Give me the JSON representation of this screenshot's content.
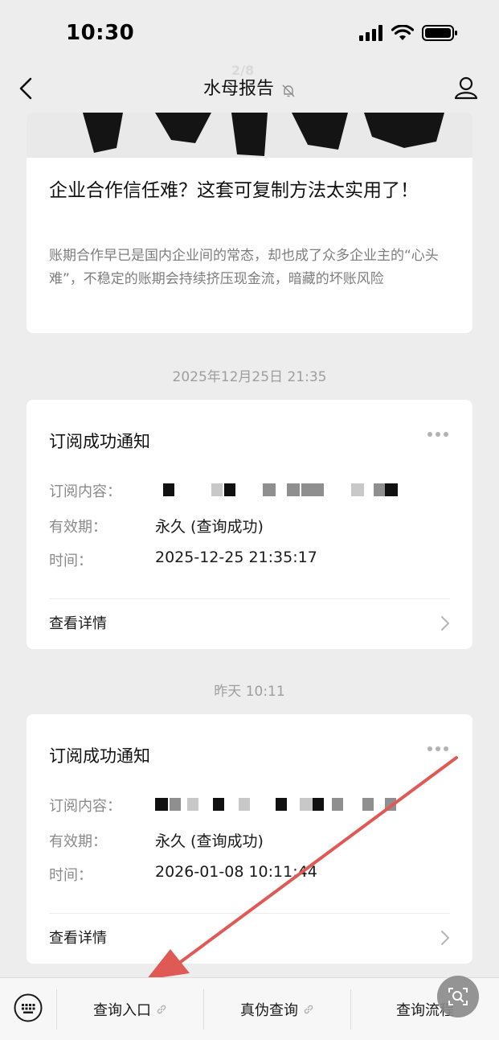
{
  "status_bar": {
    "time": "10:30"
  },
  "nav": {
    "title": "水母报告",
    "page_indicator": "2/8"
  },
  "article": {
    "title": "企业合作信任难？这套可复制方法太实用了！",
    "description": "账期合作早已是国内企业间的常态，却也成了众多企业主的“心头难”，不稳定的账期会持续挤压现金流，暗藏的坏账风险"
  },
  "messages": [
    {
      "timestamp": "2025年12月25日 21:35",
      "title": "订阅成功通知",
      "content_label": "订阅内容：",
      "validity_label": "有效期：",
      "validity_value": "永久 (查询成功)",
      "time_label": "时间：",
      "time_value": "2025-12-25 21:35:17",
      "detail_label": "查看详情"
    },
    {
      "timestamp": "昨天 10:11",
      "title": "订阅成功通知",
      "content_label": "订阅内容：",
      "validity_label": "有效期：",
      "validity_value": "永久 (查询成功)",
      "time_label": "时间：",
      "time_value": "2026-01-08 10:11:44",
      "detail_label": "查看详情"
    }
  ],
  "bottom_menu": {
    "items": [
      "查询入口",
      "真伪查询",
      "查询流程"
    ]
  },
  "colors": {
    "background": "#ededed",
    "card": "#ffffff",
    "annotation_arrow": "#e05a55"
  }
}
